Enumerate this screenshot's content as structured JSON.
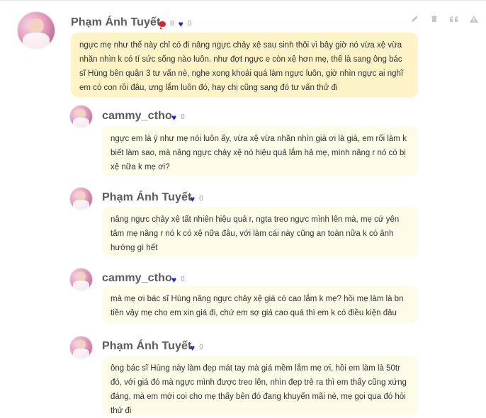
{
  "comments": [
    {
      "author": "Phạm Ánh Tuyết",
      "reply_count": "8",
      "likes": "0",
      "text": "ngực mẹ như thế này chỉ có đi nâng ngực chảy xệ sau sinh thôi vì bây giờ nó vừa xệ vừa nhăn nhìn k có tí sức sống nào luôn. như đợt ngực e còn xệ hơn mẹ, thế là sang ông bác sĩ Hùng bên quận 3 tư vấn nè, nghe xong khoái quá làm ngực luôn, giờ nhìn ngực ai nghĩ em có con rồi đâu, ưng lắm luôn đó, hay chị cũng sang đó tư vấn thử đi"
    },
    {
      "author": "cammy_ctho",
      "likes": "0",
      "text": "ngực em là ý như mẹ nói luôn ấy, vừa xệ vừa nhăn nhìn già ơi là già, em rối làm k biết làm sao, mà nâng ngực chảy xệ nó hiệu quả lắm hả mẹ, mình nâng r nó có bị xệ nữa k mẹ ơi?"
    },
    {
      "author": "Phạm Ánh Tuyết",
      "likes": "0",
      "text": "nâng ngực chảy xệ tất nhiên hiệu quả r, ngta treo ngực mình lên mà, mẹ cứ yên tâm mẹ nâng r nó k có xệ nữa đâu, với làm cái này cũng an toàn nữa k có ảnh hưởng gì hết"
    },
    {
      "author": "cammy_ctho",
      "likes": "0",
      "text": "mà mẹ ơi bác sĩ Hùng nâng ngực chảy xệ giá có cao lắm k mẹ? hồi mẹ làm là bn tiền vậy mẹ cho em xin giá đi, chứ em sợ giá cao quá thì em k có điều kiện đâu"
    },
    {
      "author": "Phạm Ánh Tuyết",
      "likes": "0",
      "text": "ông bác sĩ Hùng này làm đẹp mát tay mà giá mềm lắm mẹ ơi, hồi em làm là 50tr đó, với giá đó mà ngực mình được treo lên, nhìn đẹp trẻ ra thì em thấy cũng xứng đáng, mà em mới coi cho mẹ thấy bên đó đang khuyến mãi nè, mẹ gọi qua đó hỏi thử đi"
    }
  ],
  "colors": {
    "bubble_main": "#fdf3c6",
    "bubble_reply": "#fffbe9",
    "name": "#5a5a5a",
    "heart": "#1b2bd6",
    "speech": "#e02323"
  },
  "icons": [
    "edit-icon",
    "trash-icon",
    "quote-icon",
    "warning-icon",
    "speech-bubble-icon",
    "heart-icon"
  ]
}
